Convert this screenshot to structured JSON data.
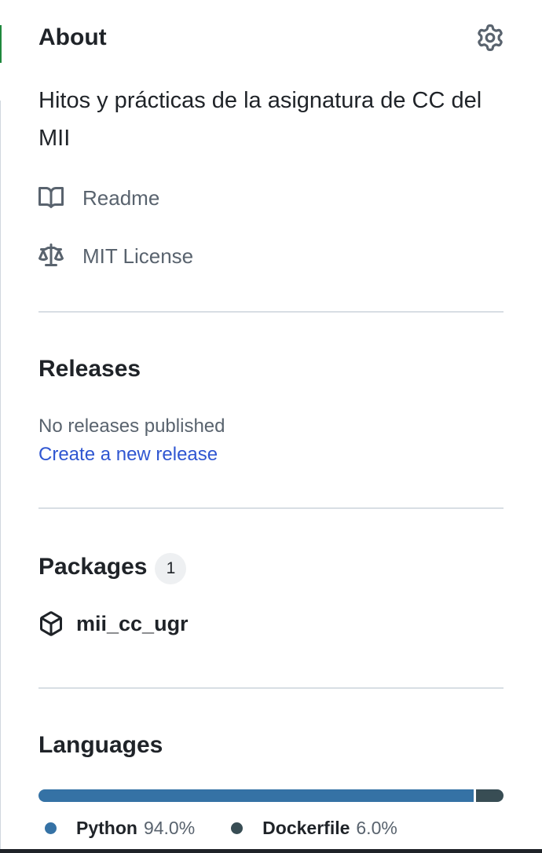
{
  "about": {
    "title": "About",
    "description": "Hitos y prácticas de la asignatura de CC del MII",
    "settings_icon": "gear-icon",
    "links": [
      {
        "label": "Readme",
        "icon": "book-icon"
      },
      {
        "label": "MIT License",
        "icon": "law-icon"
      }
    ]
  },
  "releases": {
    "title": "Releases",
    "empty_text": "No releases published",
    "create_link": "Create a new release"
  },
  "packages": {
    "title": "Packages",
    "count": "1",
    "items": [
      {
        "name": "mii_cc_ugr",
        "icon": "package-icon"
      }
    ]
  },
  "languages": {
    "title": "Languages",
    "items": [
      {
        "name": "Python",
        "percent": "94.0%",
        "share": 94.0,
        "color": "#3572A5"
      },
      {
        "name": "Dockerfile",
        "percent": "6.0%",
        "share": 6.0,
        "color": "#384d54"
      }
    ]
  },
  "colors": {
    "link": "#2f56d1",
    "muted": "#59636e",
    "accent": "#1f883d"
  }
}
